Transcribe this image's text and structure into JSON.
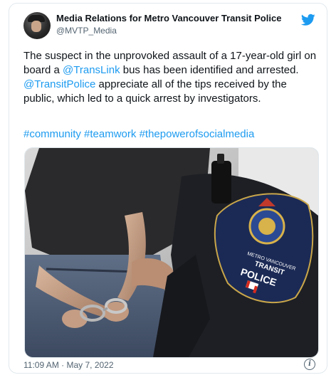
{
  "tweet": {
    "display_name": "Media Relations for Metro Vancouver Transit Police",
    "handle": "@MVTP_Media",
    "text_1": "The suspect in the unprovoked assault of a 17-year-old girl on board a ",
    "mention_1": "@TransLink",
    "text_2": " bus has been identified and arrested. ",
    "mention_2": "@TransitPolice",
    "text_3": " appreciate all of the tips received by the public, which led to a quick arrest by investigators.",
    "hashtags": [
      "#community",
      "#teamwork",
      "#thepowerofsocialmedia"
    ],
    "timestamp": "11:09 AM · May 7, 2022",
    "info_symbol": "i"
  },
  "photo": {
    "patch_line_1": "METRO VANCOUVER",
    "patch_line_2": "TRANSIT",
    "patch_line_3": "POLICE"
  },
  "icons": {
    "brand": "twitter-bird-icon",
    "info": "info-icon"
  },
  "colors": {
    "link": "#1d9bf0",
    "secondary_text": "#536471",
    "border": "#e1e8ed"
  }
}
